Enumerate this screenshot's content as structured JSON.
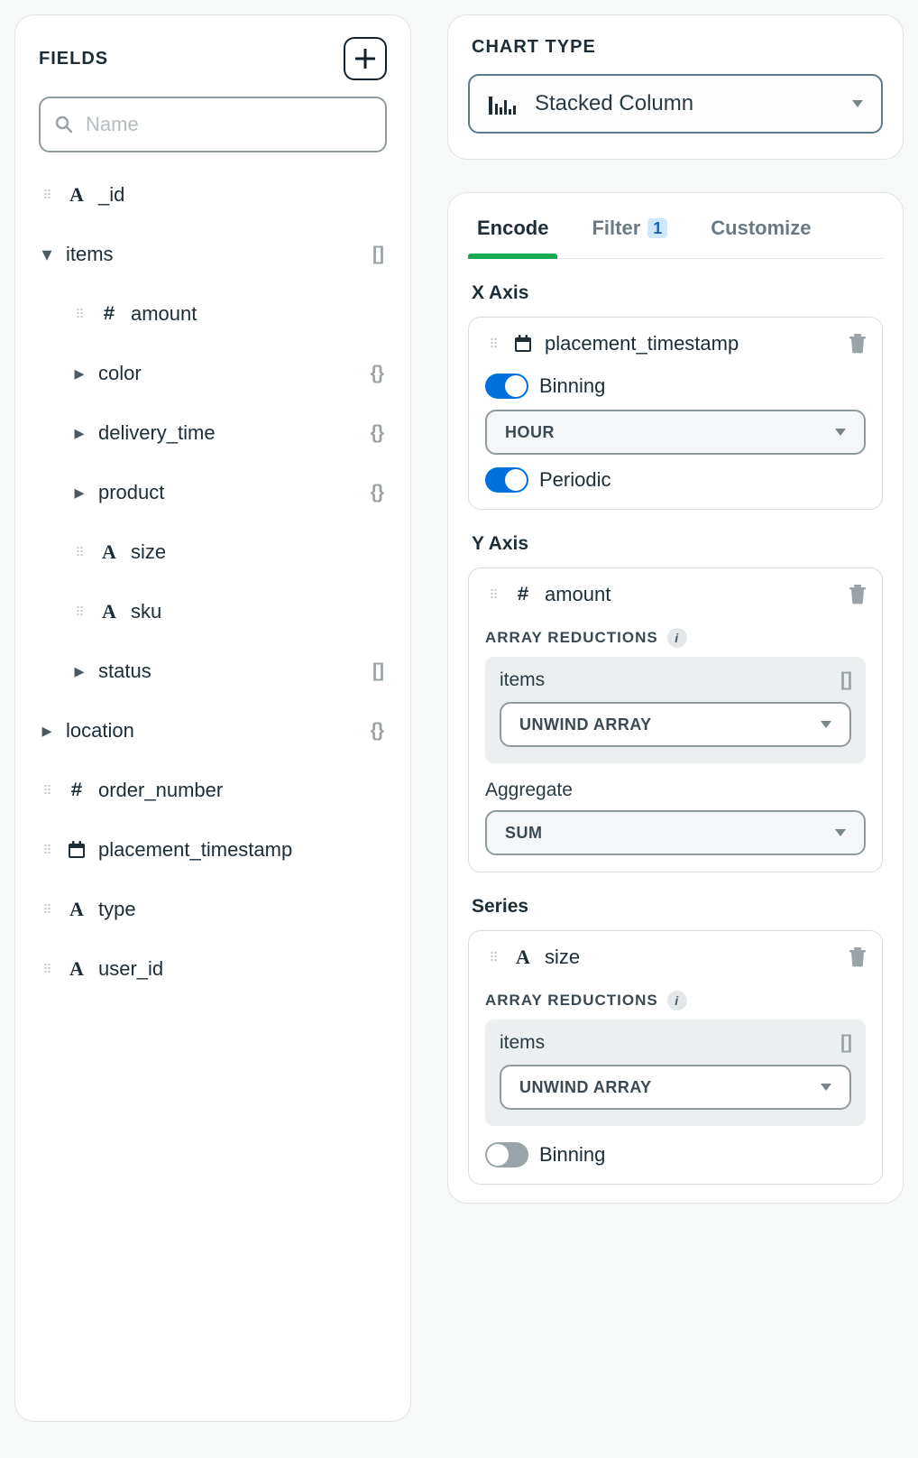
{
  "fields": {
    "title": "FIELDS",
    "search_placeholder": "Name",
    "items": [
      {
        "kind": "leaf",
        "type": "A",
        "name": "_id"
      },
      {
        "kind": "expanded",
        "type": "[]",
        "name": "items",
        "children": [
          {
            "kind": "leaf",
            "type": "#",
            "name": "amount"
          },
          {
            "kind": "collapsed",
            "type": "{}",
            "name": "color"
          },
          {
            "kind": "collapsed",
            "type": "{}",
            "name": "delivery_time"
          },
          {
            "kind": "collapsed",
            "type": "{}",
            "name": "product"
          },
          {
            "kind": "leaf",
            "type": "A",
            "name": "size"
          },
          {
            "kind": "leaf",
            "type": "A",
            "name": "sku"
          },
          {
            "kind": "collapsed",
            "type": "[]",
            "name": "status"
          }
        ]
      },
      {
        "kind": "collapsed",
        "type": "{}",
        "name": "location"
      },
      {
        "kind": "leaf",
        "type": "#",
        "name": "order_number"
      },
      {
        "kind": "leaf",
        "type": "date",
        "name": "placement_timestamp"
      },
      {
        "kind": "leaf",
        "type": "A",
        "name": "type"
      },
      {
        "kind": "leaf",
        "type": "A",
        "name": "user_id"
      }
    ]
  },
  "chartType": {
    "title": "CHART TYPE",
    "selected": "Stacked Column"
  },
  "tabs": {
    "encode": "Encode",
    "filter": "Filter",
    "filter_count": "1",
    "customize": "Customize"
  },
  "encode": {
    "x": {
      "title": "X Axis",
      "field": "placement_timestamp",
      "field_type": "date",
      "binning_label": "Binning",
      "binning_on": true,
      "bin_value": "HOUR",
      "periodic_label": "Periodic",
      "periodic_on": true
    },
    "y": {
      "title": "Y Axis",
      "field": "amount",
      "field_type": "#",
      "array_reductions_label": "ARRAY REDUCTIONS",
      "reduction_source": "items",
      "reduction_source_type": "[]",
      "reduction_value": "UNWIND ARRAY",
      "aggregate_label": "Aggregate",
      "aggregate_value": "SUM"
    },
    "series": {
      "title": "Series",
      "field": "size",
      "field_type": "A",
      "array_reductions_label": "ARRAY REDUCTIONS",
      "reduction_source": "items",
      "reduction_source_type": "[]",
      "reduction_value": "UNWIND ARRAY",
      "binning_label": "Binning",
      "binning_on": false
    }
  }
}
